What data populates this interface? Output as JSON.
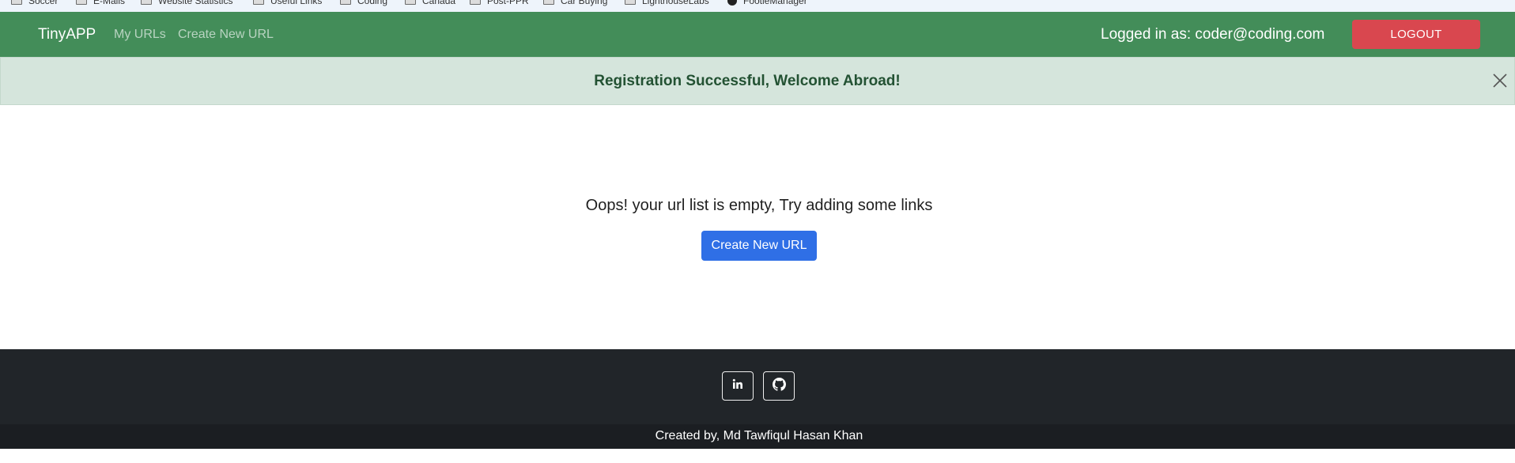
{
  "bookmarks": [
    {
      "label": "Soccer",
      "icon": "folder-icon"
    },
    {
      "label": "E-Mails",
      "icon": "folder-icon"
    },
    {
      "label": "Website Statistics",
      "icon": "folder-icon"
    },
    {
      "label": "Useful Links",
      "icon": "folder-icon"
    },
    {
      "label": "Coding",
      "icon": "folder-icon"
    },
    {
      "label": "Canada",
      "icon": "folder-icon"
    },
    {
      "label": "Post-PPR",
      "icon": "folder-icon"
    },
    {
      "label": "Car Buying",
      "icon": "folder-icon"
    },
    {
      "label": "LighthouseLabs",
      "icon": "folder-icon"
    },
    {
      "label": "FootieManager",
      "icon": "person-icon"
    }
  ],
  "navbar": {
    "brand": "TinyAPP",
    "links": [
      "My URLs",
      "Create New URL"
    ],
    "logged_in_text": "Logged in as: coder@coding.com",
    "logout_label": "LOGOUT",
    "bg_color": "#438d59",
    "logout_color": "#d9474f"
  },
  "alert": {
    "message": "Registration Successful, Welcome Abroad!",
    "close_icon": "close-icon"
  },
  "main": {
    "empty_message": "Oops! your url list is empty, Try adding some links",
    "create_button_label": "Create New URL",
    "button_color": "#2f6fe6"
  },
  "footer": {
    "social_icons": [
      "linkedin-icon",
      "github-icon"
    ],
    "credit": "Created by, Md Tawfiqul Hasan Khan"
  }
}
